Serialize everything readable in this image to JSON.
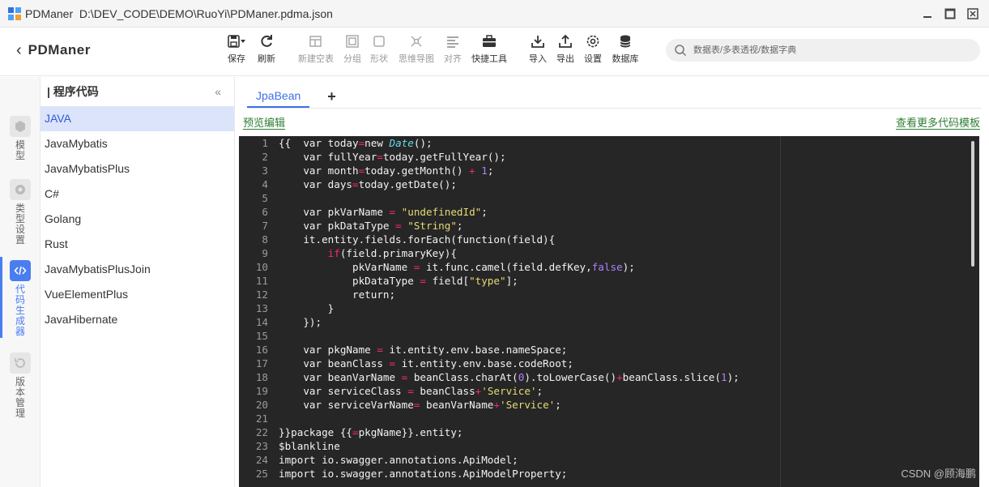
{
  "window": {
    "app_name": "PDManer",
    "file_path": "D:\\DEV_CODE\\DEMO\\RuoYi\\PDManer.pdma.json"
  },
  "toolbar": {
    "brand": "PDManer",
    "save": "保存",
    "refresh": "刷新",
    "new_table": "新建空表",
    "group": "分组",
    "shape": "形状",
    "mindmap": "思维导图",
    "align": "对齐",
    "quick_tools": "快捷工具",
    "import": "导入",
    "export": "导出",
    "settings": "设置",
    "database": "数据库"
  },
  "search": {
    "placeholder": "数据表/多表透视/数据字典"
  },
  "vnav": {
    "items": [
      {
        "label": "模型",
        "icon": "cube-icon"
      },
      {
        "label": "类型设置",
        "icon": "type-settings-icon"
      },
      {
        "label": "代码生成器",
        "icon": "code-icon"
      },
      {
        "label": "版本管理",
        "icon": "history-icon"
      }
    ],
    "active_index": 2
  },
  "template_list": {
    "title": "程序代码",
    "collapse_symbol": "«",
    "items": [
      "JAVA",
      "JavaMybatis",
      "JavaMybatisPlus",
      "C#",
      "Golang",
      "Rust",
      "JavaMybatisPlusJoin",
      "VueElementPlus",
      "JavaHibernate"
    ],
    "active_index": 0
  },
  "main": {
    "tabs": [
      {
        "label": "JpaBean"
      }
    ],
    "add_tab_symbol": "+",
    "preview_edit_link": "预览编辑",
    "more_templates_link": "查看更多代码模板"
  },
  "editor": {
    "lines": [
      {
        "n": "1"
      },
      {
        "n": "2"
      },
      {
        "n": "3"
      },
      {
        "n": "4"
      },
      {
        "n": "5"
      },
      {
        "n": "6"
      },
      {
        "n": "7"
      },
      {
        "n": "8"
      },
      {
        "n": "9"
      },
      {
        "n": "10"
      },
      {
        "n": "11"
      },
      {
        "n": "12"
      },
      {
        "n": "13"
      },
      {
        "n": "14"
      },
      {
        "n": "15"
      },
      {
        "n": "16"
      },
      {
        "n": "17"
      },
      {
        "n": "18"
      },
      {
        "n": "19"
      },
      {
        "n": "20"
      },
      {
        "n": "21"
      },
      {
        "n": "22"
      },
      {
        "n": "23"
      },
      {
        "n": "24"
      },
      {
        "n": "25"
      }
    ],
    "code": [
      "{{  var today=new Date();",
      "    var fullYear=today.getFullYear();",
      "    var month=today.getMonth() + 1;",
      "    var days=today.getDate();",
      "",
      "    var pkVarName = \"undefinedId\";",
      "    var pkDataType = \"String\";",
      "    it.entity.fields.forEach(function(field){",
      "        if(field.primaryKey){",
      "            pkVarName = it.func.camel(field.defKey,false);",
      "            pkDataType = field[\"type\"];",
      "            return;",
      "        }",
      "    });",
      "",
      "    var pkgName = it.entity.env.base.nameSpace;",
      "    var beanClass = it.entity.env.base.codeRoot;",
      "    var beanVarName = beanClass.charAt(0).toLowerCase()+beanClass.slice(1);",
      "    var serviceClass = beanClass+'Service';",
      "    var serviceVarName= beanVarName+'Service';",
      "",
      "}}package {{=pkgName}}.entity;",
      "$blankline",
      "import io.swagger.annotations.ApiModel;",
      "import io.swagger.annotations.ApiModelProperty;"
    ]
  },
  "watermark": "CSDN @顾海鹏",
  "colors": {
    "accent": "#4a7ef0",
    "link": "#2e7d32",
    "editor_bg": "#262626"
  }
}
